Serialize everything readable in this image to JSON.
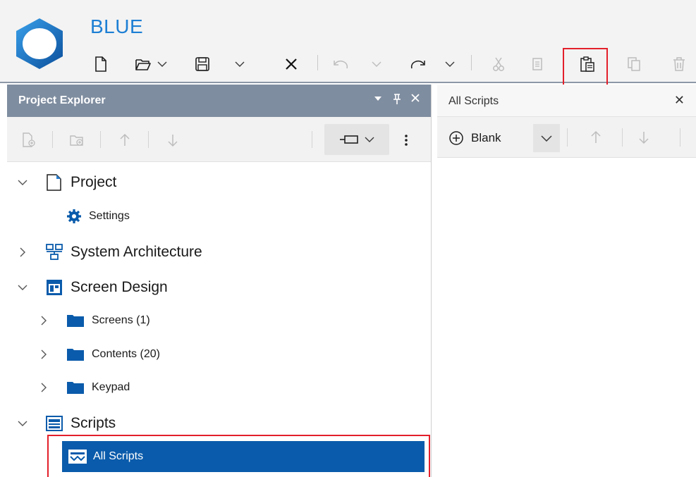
{
  "app": {
    "title": "BLUE",
    "brand_color": "#1d7fd4",
    "highlight_color": "#e3202a"
  },
  "toolbar": {
    "buttons": [
      {
        "name": "new-file",
        "icon": "new-file-icon",
        "enabled": true
      },
      {
        "name": "open",
        "icon": "open-folder-icon",
        "enabled": true,
        "has_dropdown": true
      },
      {
        "name": "save",
        "icon": "save-icon",
        "enabled": true,
        "has_dropdown": true
      },
      {
        "name": "close",
        "icon": "close-icon",
        "enabled": true
      },
      {
        "name": "undo",
        "icon": "undo-icon",
        "enabled": false,
        "has_dropdown": true
      },
      {
        "name": "redo",
        "icon": "redo-icon",
        "enabled": true,
        "has_dropdown": true
      },
      {
        "name": "cut",
        "icon": "cut-icon",
        "enabled": false
      },
      {
        "name": "copy",
        "icon": "copy-icon",
        "enabled": false
      },
      {
        "name": "paste",
        "icon": "paste-icon",
        "enabled": true,
        "highlighted": true
      },
      {
        "name": "duplicate",
        "icon": "duplicate-icon",
        "enabled": false
      },
      {
        "name": "delete",
        "icon": "delete-icon",
        "enabled": false
      }
    ]
  },
  "project_explorer": {
    "title": "Project Explorer",
    "header_color": "#7f8da0",
    "tools": [
      "add-file-icon",
      "add-folder-icon",
      "move-up-icon",
      "move-down-icon",
      "dock-icon",
      "more-options-icon"
    ],
    "tree": [
      {
        "label": "Project",
        "level": 0,
        "expanded": true,
        "icon": "project-icon"
      },
      {
        "label": "Settings",
        "level": 1,
        "icon": "gear-icon"
      },
      {
        "label": "System Architecture",
        "level": 0,
        "expanded": false,
        "icon": "architecture-icon"
      },
      {
        "label": "Screen Design",
        "level": 0,
        "expanded": true,
        "icon": "screen-design-icon"
      },
      {
        "label": "Screens (1)",
        "level": 1,
        "expanded": false,
        "icon": "folder-icon"
      },
      {
        "label": "Contents (20)",
        "level": 1,
        "expanded": false,
        "icon": "folder-icon"
      },
      {
        "label": "Keypad",
        "level": 1,
        "expanded": false,
        "icon": "folder-icon"
      },
      {
        "label": "Scripts",
        "level": 0,
        "expanded": true,
        "icon": "scripts-icon"
      },
      {
        "label": "All Scripts",
        "level": 1,
        "selected": true,
        "icon": "all-scripts-icon"
      }
    ],
    "selection_color": "#0a5bab"
  },
  "document_tab": {
    "title": "All Scripts",
    "close_glyph": "✕",
    "toolbar": {
      "blank_label": "Blank",
      "tools": [
        "add-circle-icon",
        "chevron-down-icon",
        "move-up-icon",
        "move-down-icon"
      ]
    }
  }
}
